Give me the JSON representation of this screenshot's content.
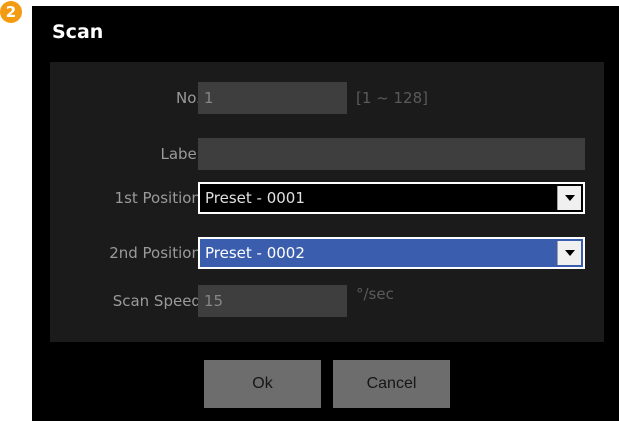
{
  "step": "2",
  "dialog": {
    "title": "Scan",
    "fields": {
      "no": {
        "label": "No.:",
        "value": "1",
        "hint": "[1 ~ 128]"
      },
      "label": {
        "label": "Label:",
        "value": ""
      },
      "pos1": {
        "label": "1st Position:",
        "value": "Preset - 0001",
        "icon": "dropdown-arrow-icon"
      },
      "pos2": {
        "label": "2nd Position:",
        "value": "Preset - 0002",
        "icon": "dropdown-arrow-icon"
      },
      "speed": {
        "label": "Scan Speed:",
        "value": "15",
        "unit": "°/sec"
      }
    },
    "buttons": {
      "ok": "Ok",
      "cancel": "Cancel"
    }
  },
  "colors": {
    "badge": "#f39c12",
    "dialog_bg": "#000000",
    "panel_bg": "#1b1b1b",
    "selected_select": "#3b5dad",
    "button_bg": "#6d6d6d"
  }
}
